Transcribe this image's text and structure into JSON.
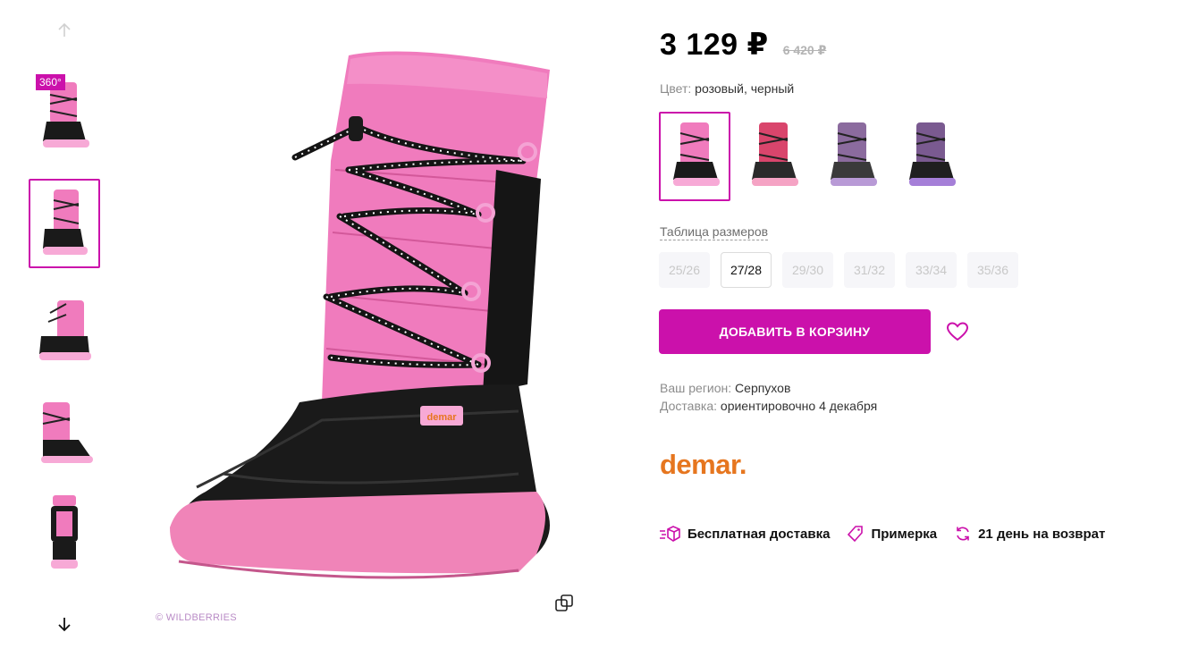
{
  "gallery": {
    "badge_360": "360°",
    "thumbnails": [
      {
        "name": "thumb-front-360",
        "variant": "pink-black"
      },
      {
        "name": "thumb-side",
        "variant": "pink-black"
      },
      {
        "name": "thumb-inner",
        "variant": "pink-black"
      },
      {
        "name": "thumb-angle",
        "variant": "pink-black"
      },
      {
        "name": "thumb-back",
        "variant": "pink-black"
      }
    ],
    "watermark": "© WILDBERRIES"
  },
  "product": {
    "price": "3 129 ₽",
    "old_price": "6 420 ₽",
    "color_label": "Цвет:",
    "color_value": "розовый, черный",
    "variants": [
      {
        "colors": [
          "#f07bbd",
          "#1a1a1a",
          "#f7a9d6"
        ]
      },
      {
        "colors": [
          "#d9456c",
          "#2a2a2a",
          "#f5a3c4"
        ]
      },
      {
        "colors": [
          "#8b6b9e",
          "#3a3a3a",
          "#b89ad6"
        ]
      },
      {
        "colors": [
          "#7a5a90",
          "#1f1f1f",
          "#a57fd8"
        ]
      }
    ],
    "size_table_label": "Таблица размеров",
    "sizes": [
      "25/26",
      "27/28",
      "29/30",
      "31/32",
      "33/34",
      "35/36"
    ],
    "selected_size": "27/28",
    "add_to_cart": "ДОБАВИТЬ В КОРЗИНУ",
    "region_label": "Ваш регион:",
    "region_value": "Серпухов",
    "delivery_label": "Доставка:",
    "delivery_value": "ориентировочно 4 декабря",
    "brand": "demar."
  },
  "features": [
    {
      "label": "Бесплатная доставка",
      "icon": "delivery-box-icon"
    },
    {
      "label": "Примерка",
      "icon": "tag-icon"
    },
    {
      "label": "21 день на возврат",
      "icon": "return-arrows-icon"
    }
  ],
  "colors": {
    "accent": "#cb11ab",
    "brand_orange": "#e6761f",
    "boot_pink": "#f07bbd",
    "boot_black": "#1a1a1a"
  }
}
